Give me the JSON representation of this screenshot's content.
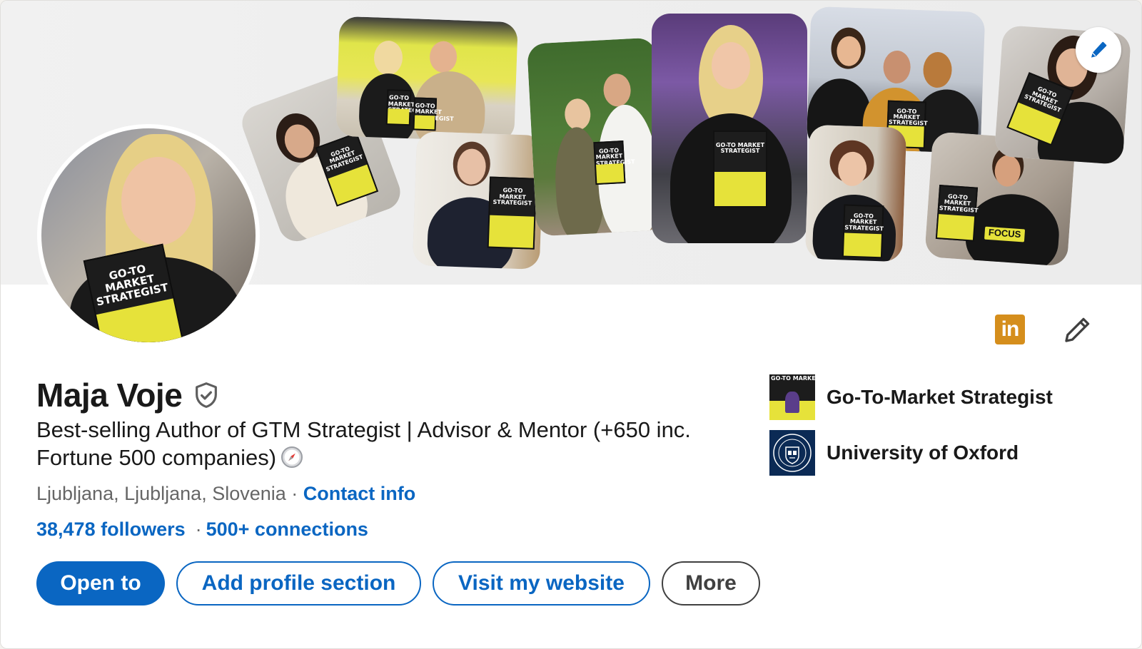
{
  "profile": {
    "name": "Maja Voje",
    "headline_line1": "Best-selling Author of GTM Strategist | Advisor & Mentor (+650 inc.",
    "headline_line2": "Fortune 500 companies)",
    "location": "Ljubljana, Ljubljana, Slovenia",
    "location_separator": "·",
    "contact_info": "Contact info",
    "followers": "38,478 followers",
    "stats_separator": "·",
    "connections": "500+ connections"
  },
  "banner": {
    "book_title": "GO-TO MARKET STRATEGIST",
    "focus_tag": "FOCUS"
  },
  "actions": {
    "open_to": "Open to",
    "add_profile_section": "Add profile section",
    "visit_website": "Visit my website",
    "more": "More"
  },
  "side": {
    "current_position": "Go-To-Market Strategist",
    "education": "University of Oxford",
    "linkedin_badge": "in"
  },
  "colors": {
    "accent": "#0a66c2",
    "book_yellow": "#e6e23a",
    "linkedin_badge": "#d58e1c",
    "oxford_blue": "#0b2a55"
  },
  "icons": [
    "pencil-icon",
    "verified-shield-icon",
    "compass-icon",
    "linkedin-icon",
    "book-logo-icon",
    "oxford-crest-icon"
  ]
}
